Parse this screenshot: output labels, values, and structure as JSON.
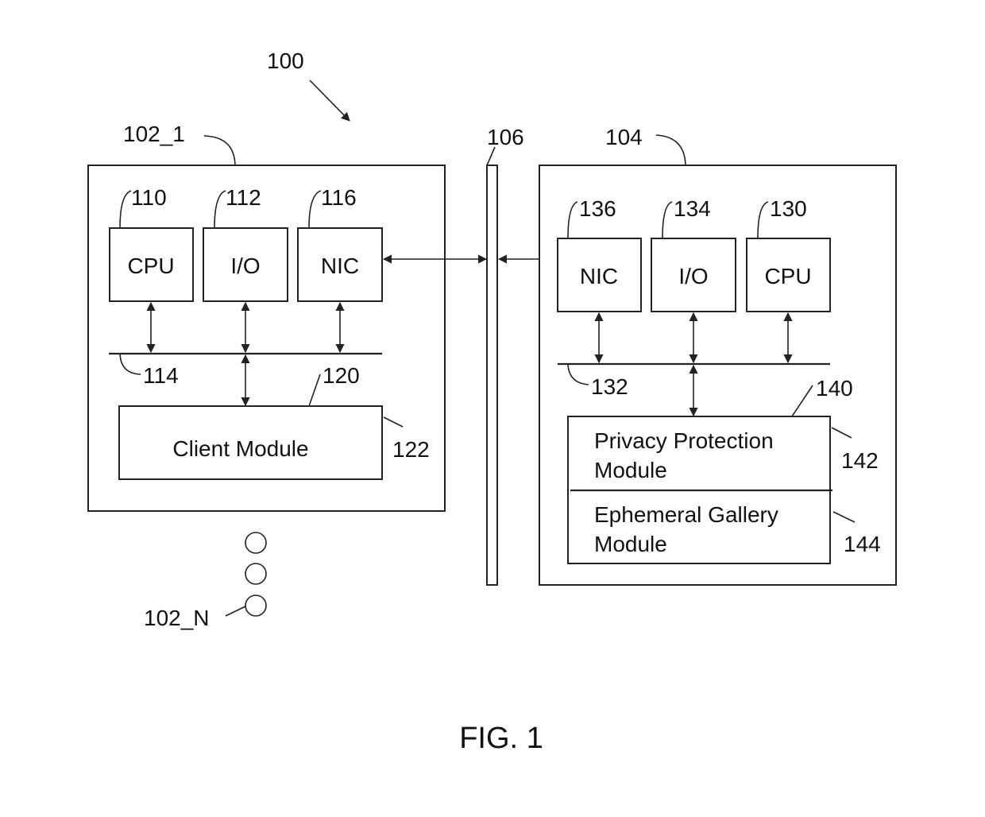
{
  "figure": {
    "title": "FIG. 1",
    "system_ref": "100"
  },
  "client_device": {
    "ref": "102_1",
    "components": [
      {
        "label": "CPU",
        "ref": "110"
      },
      {
        "label": "I/O",
        "ref": "112"
      },
      {
        "label": "NIC",
        "ref": "116"
      }
    ],
    "bus_ref": "114",
    "memory_ref": "120",
    "module": {
      "label": "Client Module",
      "ref": "122"
    }
  },
  "additional_clients": {
    "ref": "102_N",
    "ellipsis_count": 3
  },
  "network": {
    "ref": "106"
  },
  "server": {
    "ref": "104",
    "components": [
      {
        "label": "NIC",
        "ref": "136"
      },
      {
        "label": "I/O",
        "ref": "134"
      },
      {
        "label": "CPU",
        "ref": "130"
      }
    ],
    "bus_ref": "132",
    "memory_ref": "140",
    "modules": [
      {
        "line1": "Privacy Protection",
        "line2": "Module",
        "ref": "142"
      },
      {
        "line1": "Ephemeral Gallery",
        "line2": "Module",
        "ref": "144"
      }
    ]
  },
  "colors": {
    "line": "#222222",
    "background": "#ffffff"
  }
}
